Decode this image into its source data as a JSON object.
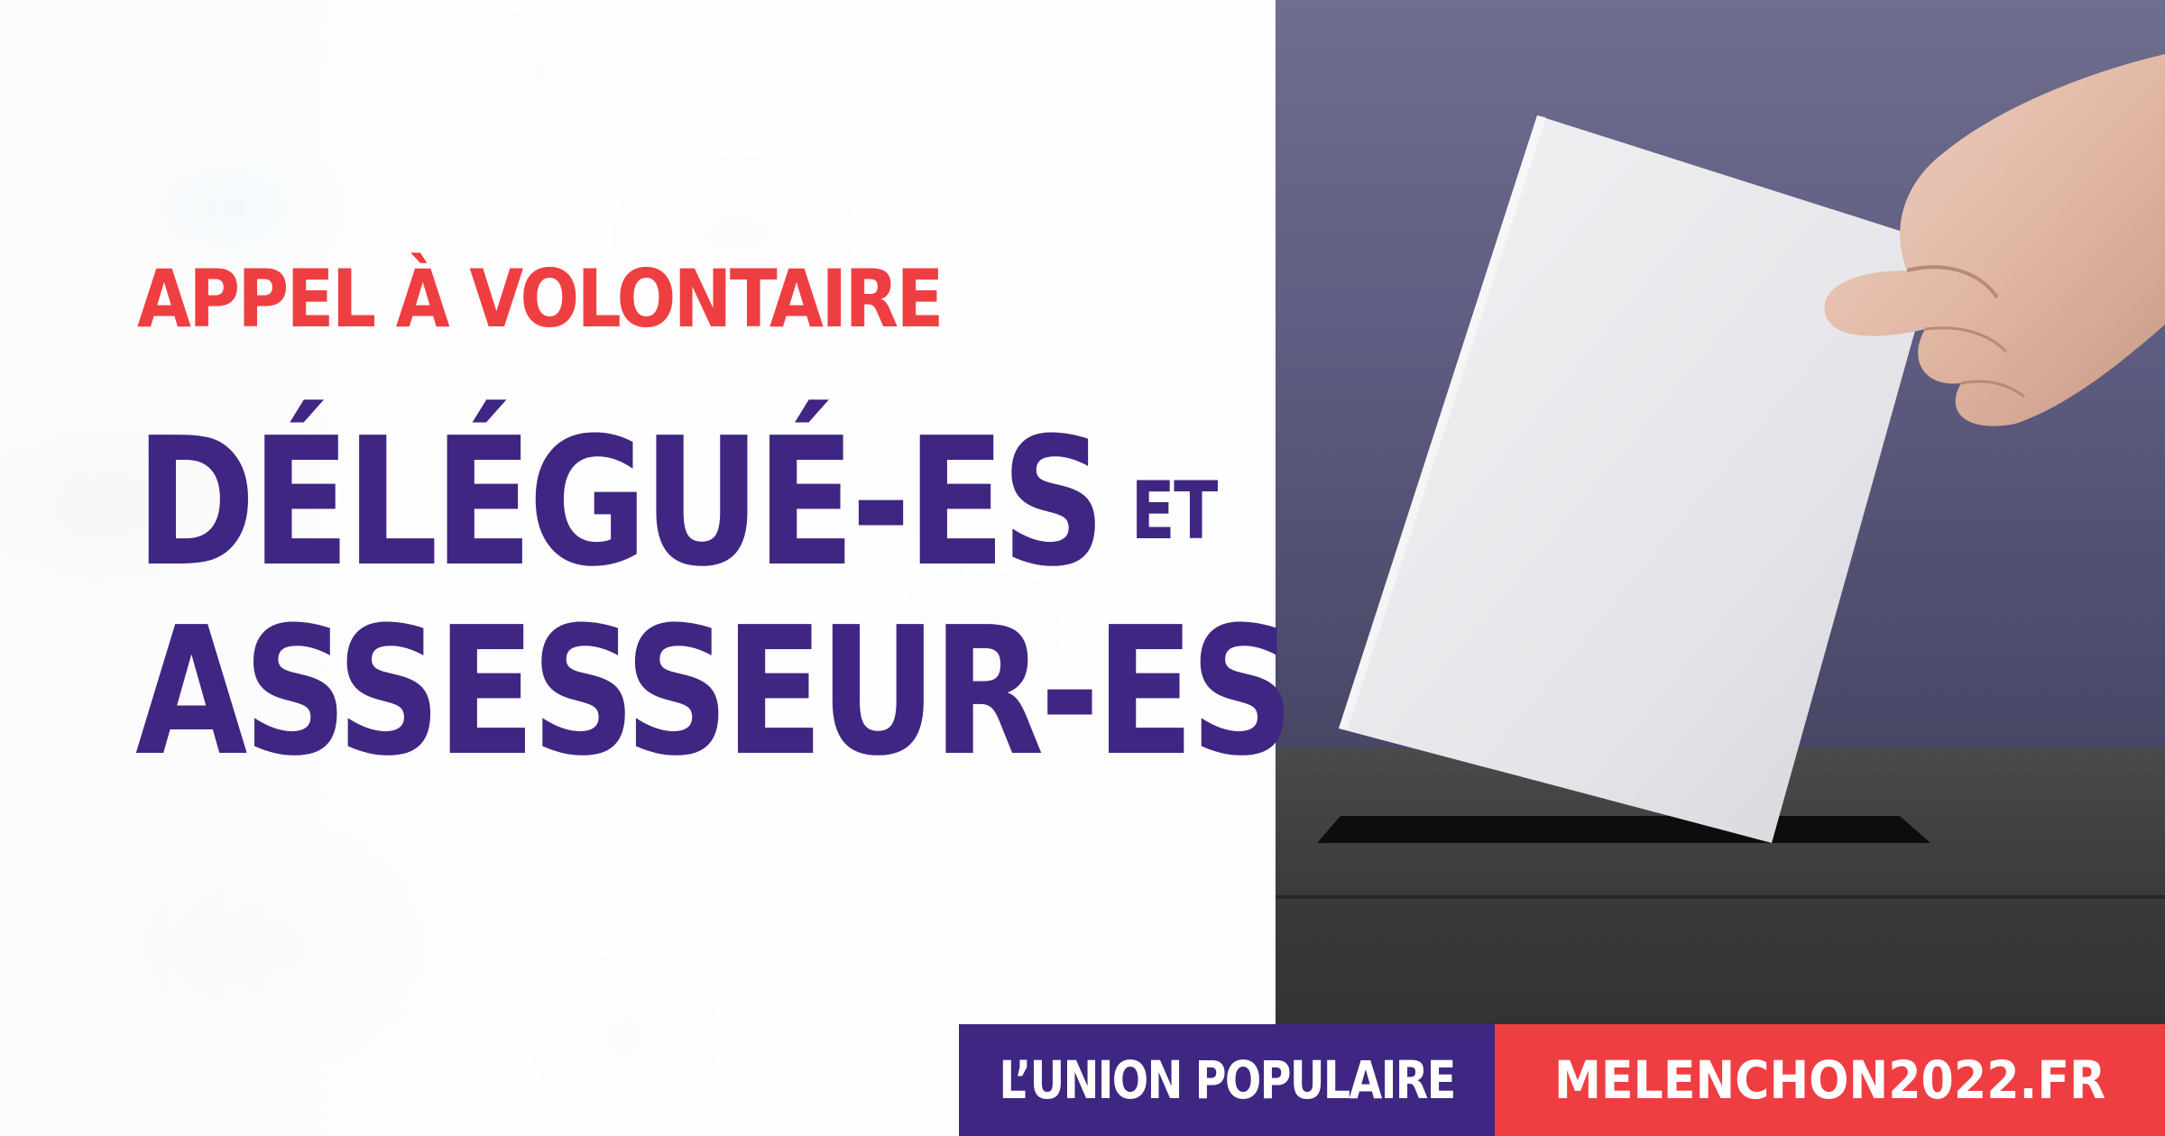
{
  "banner": {
    "kicker": "APPEL À VOLONTAIRE",
    "title_line_1": "DÉLÉGUÉ-ES",
    "title_connector": "ET",
    "title_line_2": "ASSESSEUR-ES"
  },
  "footer": {
    "organization": "L’UNION POPULAIRE",
    "website": "MELENCHON2022.FR"
  },
  "colors": {
    "accent_red": "#ef3e42",
    "brand_purple": "#3f2682",
    "white": "#ffffff"
  },
  "photo": {
    "subject": "hand-inserting-ballot-into-box"
  }
}
